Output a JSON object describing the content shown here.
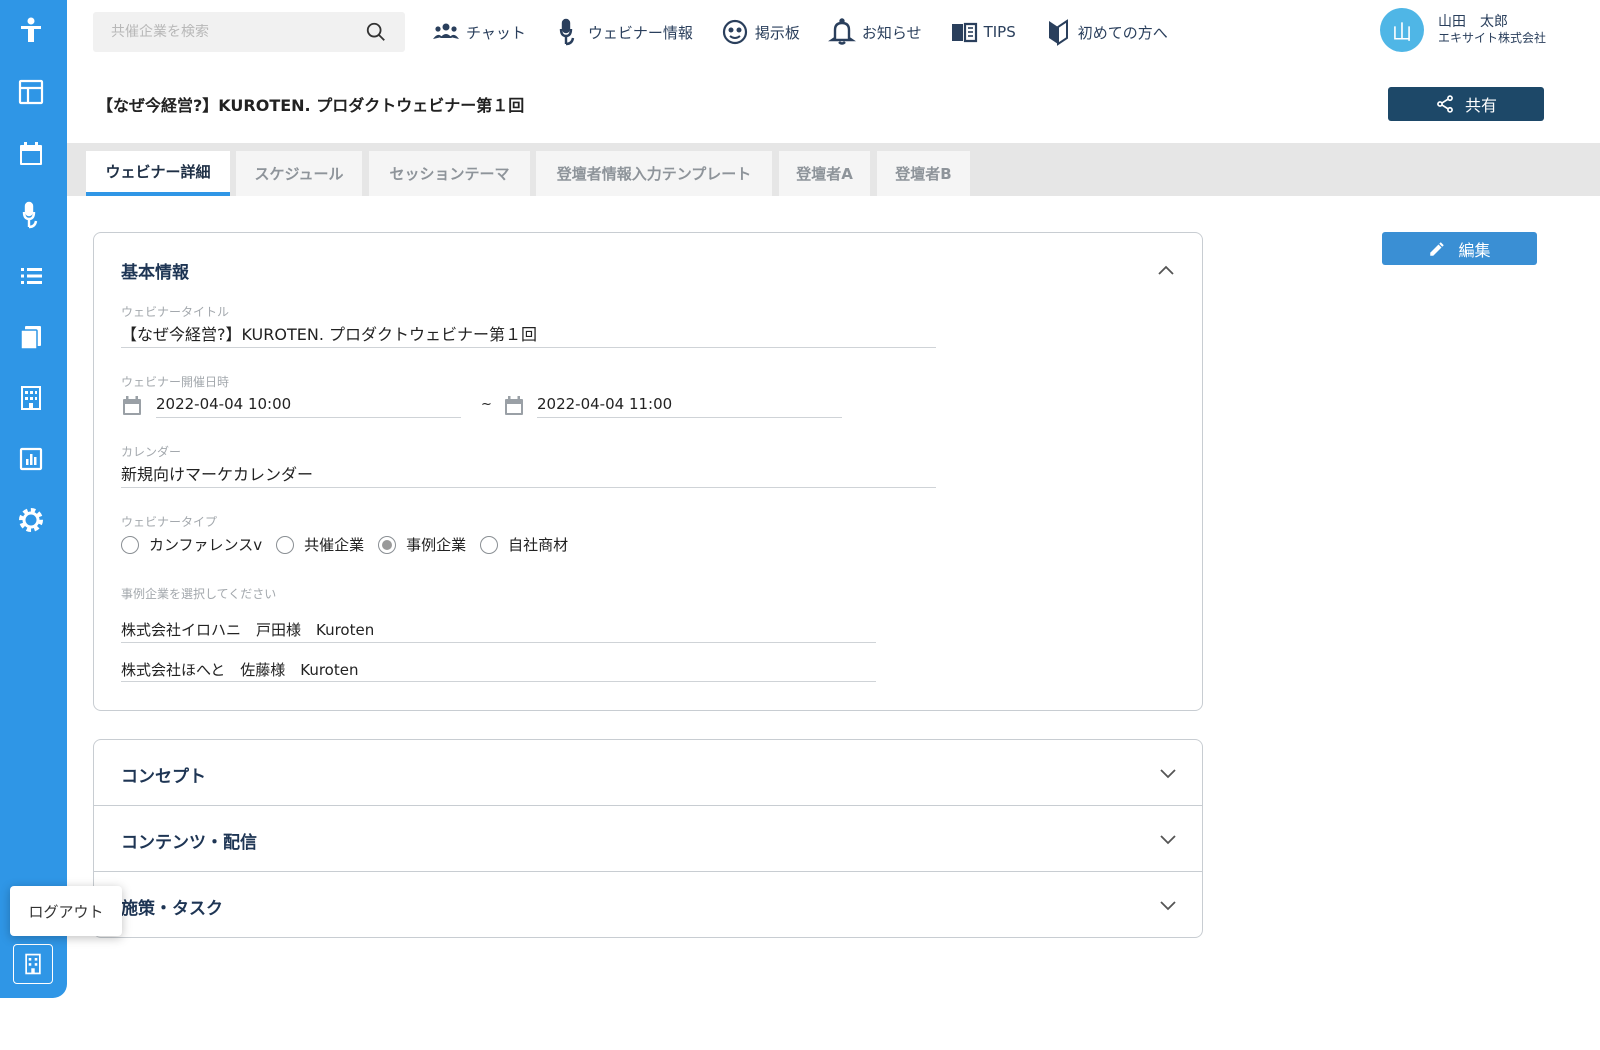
{
  "header": {
    "search_placeholder": "共催企業を検索",
    "nav": [
      {
        "label": "チャット",
        "icon": "people-icon"
      },
      {
        "label": "ウェビナー情報",
        "icon": "microphone-icon"
      },
      {
        "label": "掲示板",
        "icon": "board-icon"
      },
      {
        "label": "お知らせ",
        "icon": "bell-icon"
      },
      {
        "label": "TIPS",
        "icon": "book-icon"
      },
      {
        "label": "初めての方へ",
        "icon": "beginner-mark-icon"
      }
    ],
    "user": {
      "avatar": "山",
      "name": "山田　太郎",
      "company": "エキサイト株式会社"
    }
  },
  "page": {
    "title": "【なぜ今経営?】KUROTEN. プロダクトウェビナー第１回",
    "share_label": "共有",
    "edit_label": "編集"
  },
  "tabs": [
    {
      "label": "ウェビナー詳細",
      "active": true
    },
    {
      "label": "スケジュール"
    },
    {
      "label": "セッションテーマ"
    },
    {
      "label": "登壇者情報入力テンプレート"
    },
    {
      "label": "登壇者A"
    },
    {
      "label": "登壇者B"
    }
  ],
  "basic": {
    "title": "基本情報",
    "webinar_title_label": "ウェビナータイトル",
    "webinar_title": "【なぜ今経営?】KUROTEN. プロダクトウェビナー第１回",
    "datetime_label": "ウェビナー開催日時",
    "start": "2022-04-04 10:00",
    "tilde": "~",
    "end": "2022-04-04 11:00",
    "calendar_label": "カレンダー",
    "calendar_value": "新規向けマーケカレンダー",
    "type_label": "ウェビナータイプ",
    "types": [
      "カンファレンスv",
      "共催企業",
      "事例企業",
      "自社商材"
    ],
    "selected_type": "事例企業",
    "company_label": "事例企業を選択してください",
    "companies": [
      "株式会社イロハニ　戸田様　Kuroten",
      "株式会社ほへと　佐藤様　Kuroten"
    ]
  },
  "accordions": [
    "コンセプト",
    "コンテンツ・配信",
    "施策・タスク"
  ],
  "sidebar": {
    "logout_label": "ログアウト"
  }
}
